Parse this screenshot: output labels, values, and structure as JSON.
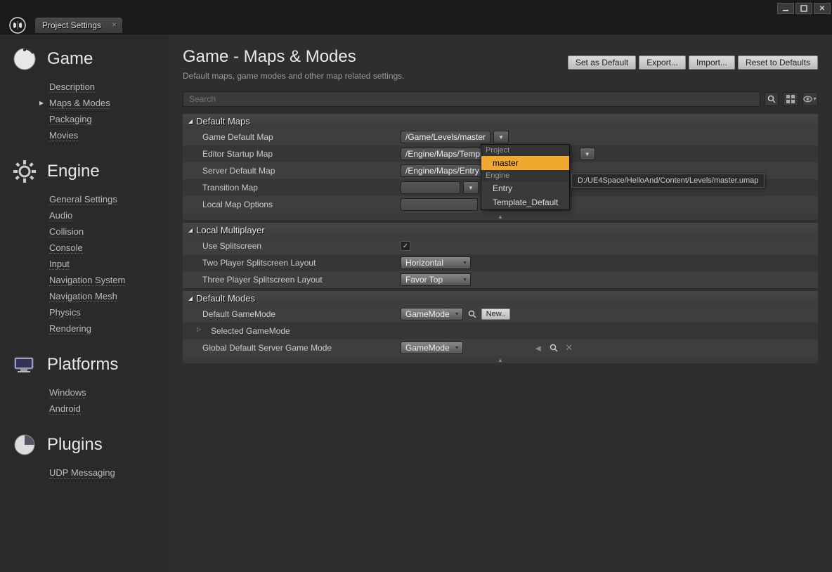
{
  "tab_title": "Project Settings",
  "sidebar": {
    "sections": [
      {
        "title": "Game",
        "items": [
          "Description",
          "Maps & Modes",
          "Packaging",
          "Movies"
        ]
      },
      {
        "title": "Engine",
        "items": [
          "General Settings",
          "Audio",
          "Collision",
          "Console",
          "Input",
          "Navigation System",
          "Navigation Mesh",
          "Physics",
          "Rendering"
        ]
      },
      {
        "title": "Platforms",
        "items": [
          "Windows",
          "Android"
        ]
      },
      {
        "title": "Plugins",
        "items": [
          "UDP Messaging"
        ]
      }
    ]
  },
  "main": {
    "title": "Game - Maps & Modes",
    "subtitle": "Default maps, game modes and other map related settings.",
    "buttons": {
      "set_default": "Set as Default",
      "export": "Export...",
      "import": "Import...",
      "reset": "Reset to Defaults"
    },
    "search_placeholder": "Search"
  },
  "sections": {
    "default_maps": {
      "title": "Default Maps",
      "rows": {
        "game_default_map": {
          "label": "Game Default Map",
          "value": "/Game/Levels/master"
        },
        "editor_startup_map": {
          "label": "Editor Startup Map",
          "value": "/Engine/Maps/Templat"
        },
        "server_default_map": {
          "label": "Server Default Map",
          "value": "/Engine/Maps/Entry"
        },
        "transition_map": {
          "label": "Transition Map",
          "value": ""
        },
        "local_map_options": {
          "label": "Local Map Options",
          "value": ""
        }
      }
    },
    "local_multiplayer": {
      "title": "Local Multiplayer",
      "rows": {
        "use_splitscreen": {
          "label": "Use Splitscreen",
          "checked": true
        },
        "two_player": {
          "label": "Two Player Splitscreen Layout",
          "value": "Horizontal"
        },
        "three_player": {
          "label": "Three Player Splitscreen Layout",
          "value": "Favor Top"
        }
      }
    },
    "default_modes": {
      "title": "Default Modes",
      "rows": {
        "default_gamemode": {
          "label": "Default GameMode",
          "value": "GameMode",
          "new_btn": "New.."
        },
        "selected_gamemode": {
          "label": "Selected GameMode"
        },
        "global_server": {
          "label": "Global Default Server Game Mode",
          "value": "GameMode"
        }
      }
    }
  },
  "popup": {
    "cat1": "Project",
    "item1": "master",
    "cat2": "Engine",
    "item2": "Entry",
    "item3": "Template_Default"
  },
  "tooltip": "D:/UE4Space/HelloAnd/Content/Levels/master.umap"
}
